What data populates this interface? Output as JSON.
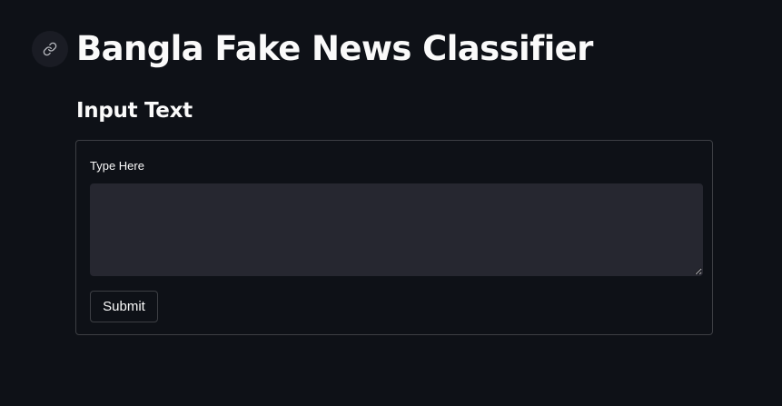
{
  "header": {
    "title": "Bangla Fake News Classifier",
    "anchor_icon": "link-icon"
  },
  "section": {
    "heading": "Input Text"
  },
  "form": {
    "field_label": "Type Here",
    "textarea_value": "",
    "textarea_placeholder": "",
    "submit_label": "Submit"
  },
  "colors": {
    "background": "#0e1117",
    "input_background": "#262730",
    "text": "#fafafa",
    "border": "rgba(250,250,250,0.2)"
  }
}
